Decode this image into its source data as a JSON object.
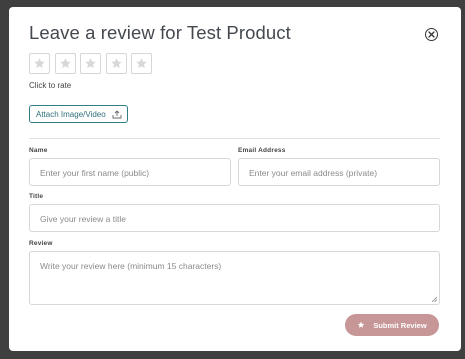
{
  "modal": {
    "title": "Leave a review for Test Product",
    "rate_hint": "Click to rate",
    "attach_label": "Attach Image/Video",
    "fields": {
      "name_label": "Name",
      "name_placeholder": "Enter your first name (public)",
      "email_label": "Email Address",
      "email_placeholder": "Enter your email address (private)",
      "title_label": "Title",
      "title_placeholder": "Give your review a title",
      "review_label": "Review",
      "review_placeholder": "Write your review here (minimum 15 characters)"
    },
    "submit_label": "Submit Review",
    "rating": {
      "max": 5,
      "selected": 0
    }
  },
  "icons": {
    "close": "close-circle-icon",
    "star": "star-icon",
    "attach": "upload-icon",
    "submit": "star-icon"
  },
  "colors": {
    "accent": "#2f7d87",
    "submit_bg": "#c79696",
    "star_empty": "#d8d8d8"
  }
}
